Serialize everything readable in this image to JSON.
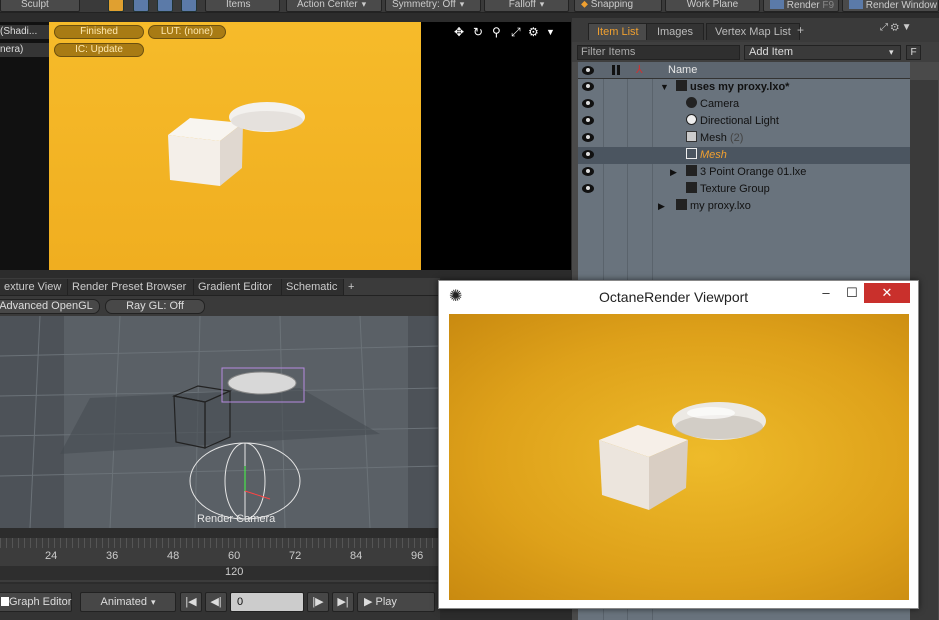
{
  "toolbar": {
    "sculpt": "Sculpt",
    "items": "Items",
    "action_center": "Action Center",
    "symmetry": "Symmetry: Off",
    "falloff": "Falloff",
    "snapping": "Snapping",
    "work_plane": "Work Plane",
    "render": "Render",
    "render_key": "F9",
    "render_window": "Render Window"
  },
  "viewport_top": {
    "left_labels": [
      "(Shadi...",
      "nera)"
    ],
    "pills": {
      "status": "Finished",
      "lut": "LUT: (none)",
      "ic": "IC: Update"
    }
  },
  "mid_tabs": [
    "exture View",
    "Render Preset Browser",
    "Gradient Editor",
    "Schematic"
  ],
  "mid_tabs_add": "+",
  "gl_bar": {
    "opengl": "Advanced OpenGL",
    "raygl": "Ray GL: Off"
  },
  "gl_view": {
    "camera_label": "Render Camera"
  },
  "timeline": {
    "ticks": [
      "24",
      "36",
      "48",
      "60",
      "72",
      "84",
      "96"
    ],
    "current": "120"
  },
  "bottom_bar": {
    "graph_editor": "Graph Editor",
    "animated": "Animated",
    "frame": "0",
    "play": "Play"
  },
  "right_panel": {
    "tabs": [
      "Item List",
      "Images",
      "Vertex Map List"
    ],
    "tab_add": "+",
    "filter_placeholder": "Filter Items",
    "add_item": "Add Item",
    "f_btn": "F",
    "name_header": "Name",
    "items": [
      {
        "label": "uses my proxy.lxo*",
        "bold": true,
        "indent": 0
      },
      {
        "label": "Camera",
        "indent": 1
      },
      {
        "label": "Directional Light",
        "indent": 1
      },
      {
        "label": "Mesh",
        "suffix": "(2)",
        "indent": 1
      },
      {
        "label": "Mesh",
        "indent": 1,
        "selected": true
      },
      {
        "label": "3 Point Orange 01.lxe",
        "indent": 1
      },
      {
        "label": "Texture Group",
        "indent": 1
      },
      {
        "label": "my proxy.lxo",
        "indent": 0
      }
    ]
  },
  "octane": {
    "title": "OctaneRender Viewport",
    "minimize": "–",
    "maximize": "☐",
    "close": "✕"
  },
  "colors": {
    "accent": "#f0a030",
    "render_bg": "#f0b020",
    "close_red": "#c9302c"
  }
}
